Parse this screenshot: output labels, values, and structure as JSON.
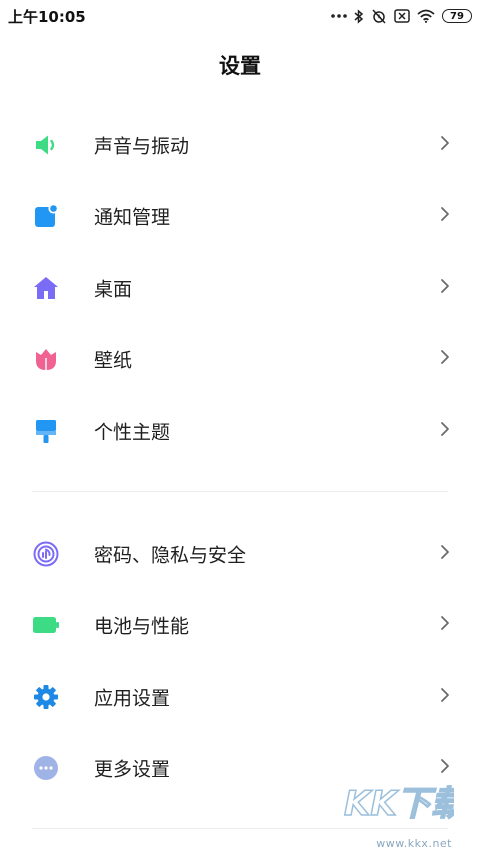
{
  "status_bar": {
    "time": "上午10:05",
    "battery_level": "79",
    "icons": [
      "more-dots-icon",
      "bluetooth-icon",
      "alarm-off-icon",
      "sim-off-icon",
      "wifi-icon",
      "battery-icon"
    ]
  },
  "page": {
    "title": "设置"
  },
  "groups": [
    {
      "items": [
        {
          "label": "声音与振动",
          "icon": "speaker-icon",
          "color": "#3ddc84"
        },
        {
          "label": "通知管理",
          "icon": "notification-icon",
          "color": "#2196f3"
        },
        {
          "label": "桌面",
          "icon": "home-icon",
          "color": "#7b6cf6"
        },
        {
          "label": "壁纸",
          "icon": "tulip-icon",
          "color": "#f06292"
        },
        {
          "label": "个性主题",
          "icon": "brush-icon",
          "color": "#2196f3"
        }
      ]
    },
    {
      "items": [
        {
          "label": "密码、隐私与安全",
          "icon": "fingerprint-icon",
          "color": "#7b6cf6"
        },
        {
          "label": "电池与性能",
          "icon": "battery-icon",
          "color": "#3ddc84"
        },
        {
          "label": "应用设置",
          "icon": "gear-icon",
          "color": "#1e88e5"
        },
        {
          "label": "更多设置",
          "icon": "more-icon",
          "color": "#9fb3e6"
        }
      ]
    }
  ],
  "watermark": {
    "brand": "KK下载",
    "url": "www.kkx.net"
  }
}
